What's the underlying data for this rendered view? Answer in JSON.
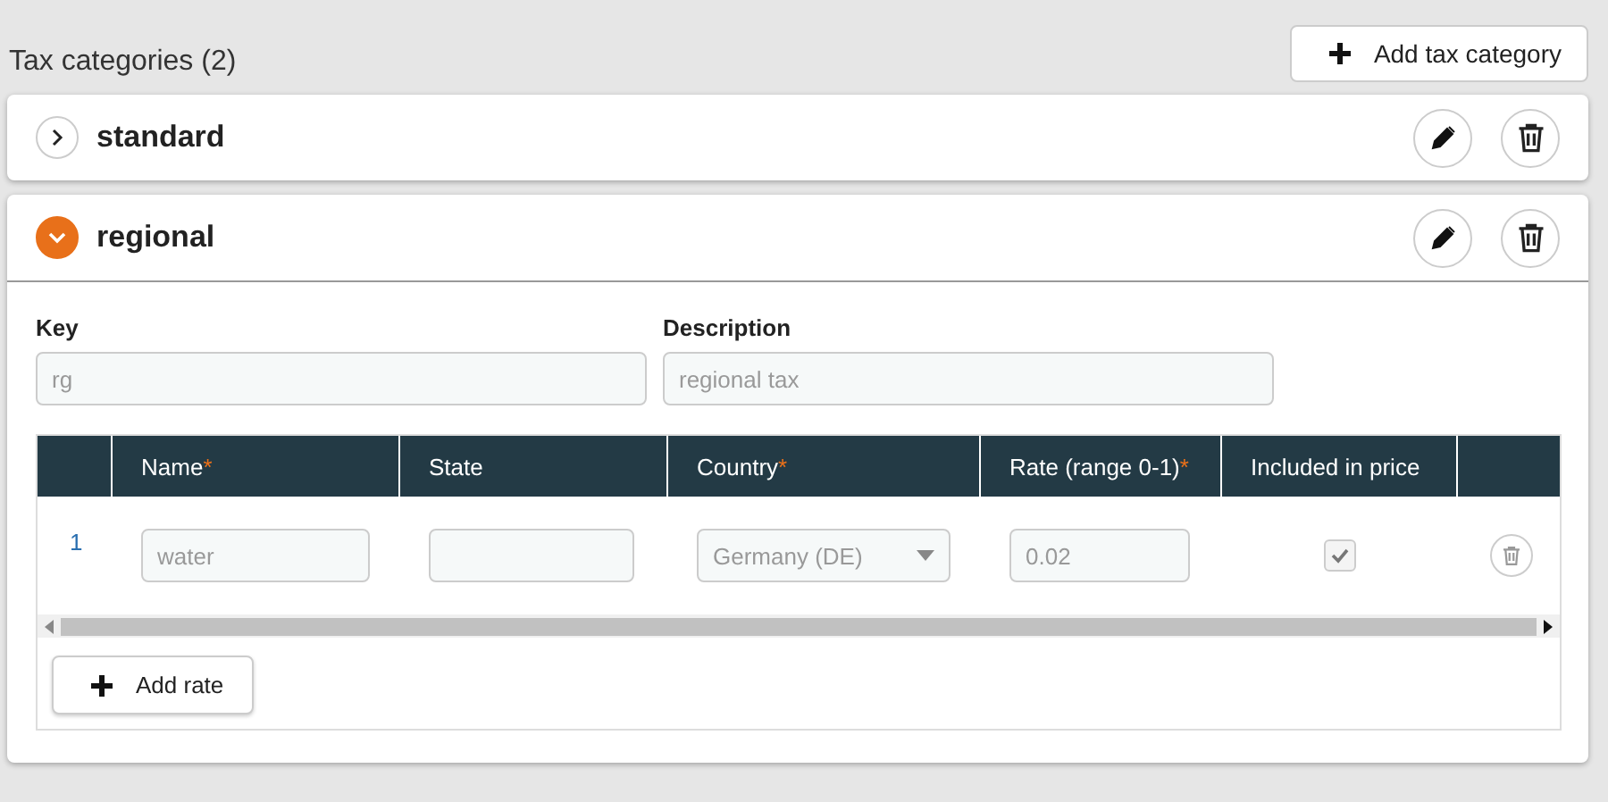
{
  "header": {
    "title": "Tax categories (2)",
    "add_button": "Add tax category"
  },
  "categories": [
    {
      "name": "standard",
      "expanded": false
    },
    {
      "name": "regional",
      "expanded": true,
      "fields": [
        {
          "label": "Key",
          "value": "rg",
          "disabled": true
        },
        {
          "label": "Description",
          "value": "regional tax",
          "disabled": true
        }
      ],
      "rates": {
        "columns": [
          {
            "label": "Name",
            "required_mark": "*"
          },
          {
            "label": "State"
          },
          {
            "label": "Country",
            "required_mark": "*"
          },
          {
            "label": "Rate (range 0-1)",
            "required_mark": "*"
          },
          {
            "label": "Included in price"
          }
        ],
        "rows": [
          {
            "index": "1",
            "name": "water",
            "country": "Germany (DE)",
            "rate": "0.02",
            "included": true,
            "disabled": true
          }
        ]
      },
      "add_rate": "Add rate"
    }
  ]
}
